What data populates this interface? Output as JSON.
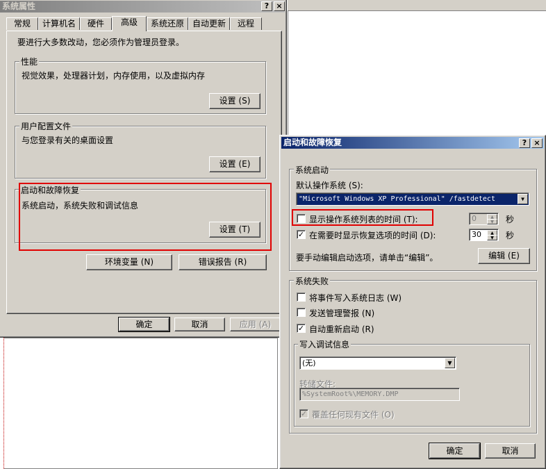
{
  "sys_props": {
    "title": "系统属性",
    "help_btn": "?",
    "close_btn": "×",
    "tabs": [
      "常规",
      "计算机名",
      "硬件",
      "高级",
      "系统还原",
      "自动更新",
      "远程"
    ],
    "admin_note": "要进行大多数改动，您必须作为管理员登录。",
    "performance": {
      "label": "性能",
      "desc": "视觉效果，处理器计划，内存使用，以及虚拟内存",
      "button": "设置 (S)"
    },
    "user_profiles": {
      "label": "用户配置文件",
      "desc": "与您登录有关的桌面设置",
      "button": "设置 (E)"
    },
    "startup_recovery": {
      "label": "启动和故障恢复",
      "desc": "系统启动，系统失败和调试信息",
      "button": "设置 (T)"
    },
    "env_button": "环境变量 (N)",
    "error_report_button": "错误报告 (R)",
    "ok": "确定",
    "cancel": "取消",
    "apply": "应用 (A)"
  },
  "startup_dialog": {
    "title": "启动和故障恢复",
    "help_btn": "?",
    "close_btn": "×",
    "system_startup": {
      "label": "系统启动",
      "default_os_label": "默认操作系统 (S):",
      "default_os_value": "\"Microsoft Windows XP Professional\" /fastdetect",
      "show_os_list": {
        "label": "显示操作系统列表的时间 (T):",
        "checked": false,
        "value": "0",
        "unit": "秒"
      },
      "show_recovery": {
        "label": "在需要时显示恢复选项的时间 (D):",
        "checked": true,
        "value": "30",
        "unit": "秒"
      },
      "edit_note": "要手动编辑启动选项，请单击“编辑”。",
      "edit_button": "编辑 (E)"
    },
    "system_failure": {
      "label": "系统失败",
      "write_event_log": {
        "label": "将事件写入系统日志 (W)",
        "checked": false
      },
      "send_alert": {
        "label": "发送管理警报 (N)",
        "checked": false
      },
      "auto_restart": {
        "label": "自动重新启动 (R)",
        "checked": true
      }
    },
    "debug_info": {
      "label": "写入调试信息",
      "selected": "(无)",
      "dump_file_label": "转储文件:",
      "dump_file_value": "%SystemRoot%\\MEMORY.DMP",
      "overwrite": {
        "label": "覆盖任何现有文件 (O)",
        "checked": true
      }
    },
    "ok": "确定",
    "cancel": "取消"
  },
  "icons": {
    "check": "✓",
    "dropdown": "▼",
    "spin_up": "▲",
    "spin_down": "▼"
  },
  "colors": {
    "face": "#d4d0c8",
    "active_title": "#0a246a",
    "highlight": "#e00000"
  }
}
